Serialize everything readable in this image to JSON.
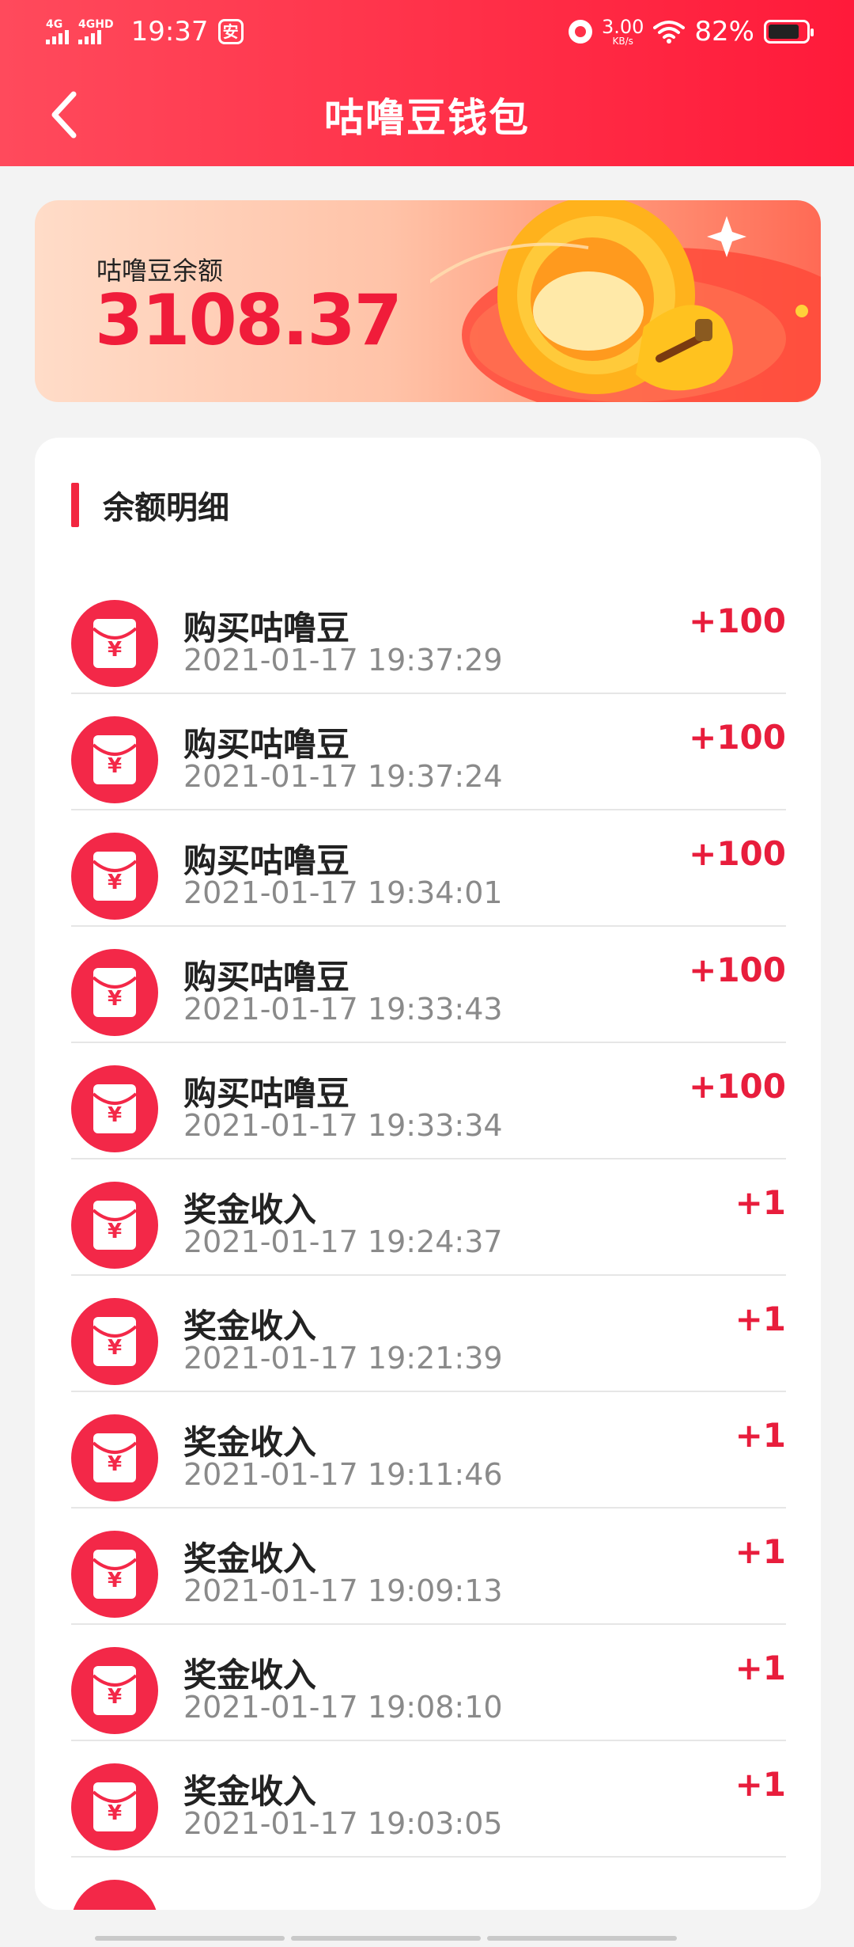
{
  "status_bar": {
    "network_1": "4G",
    "network_2": "4GHD",
    "time": "19:37",
    "app_badge": "安",
    "speed_value": "3.00",
    "speed_unit": "KB/s",
    "battery": "82%",
    "battery_level": 0.82
  },
  "header": {
    "title": "咕噜豆钱包",
    "back_icon": "chevron-left-icon"
  },
  "balance": {
    "label": "咕噜豆余额",
    "value": "3108.37"
  },
  "details": {
    "title": "余额明细",
    "transactions": [
      {
        "title": "购买咕噜豆",
        "time": "2021-01-17 19:37:29",
        "amount": "+100"
      },
      {
        "title": "购买咕噜豆",
        "time": "2021-01-17 19:37:24",
        "amount": "+100"
      },
      {
        "title": "购买咕噜豆",
        "time": "2021-01-17 19:34:01",
        "amount": "+100"
      },
      {
        "title": "购买咕噜豆",
        "time": "2021-01-17 19:33:43",
        "amount": "+100"
      },
      {
        "title": "购买咕噜豆",
        "time": "2021-01-17 19:33:34",
        "amount": "+100"
      },
      {
        "title": "奖金收入",
        "time": "2021-01-17 19:24:37",
        "amount": "+1"
      },
      {
        "title": "奖金收入",
        "time": "2021-01-17 19:21:39",
        "amount": "+1"
      },
      {
        "title": "奖金收入",
        "time": "2021-01-17 19:11:46",
        "amount": "+1"
      },
      {
        "title": "奖金收入",
        "time": "2021-01-17 19:09:13",
        "amount": "+1"
      },
      {
        "title": "奖金收入",
        "time": "2021-01-17 19:08:10",
        "amount": "+1"
      },
      {
        "title": "奖金收入",
        "time": "2021-01-17 19:03:05",
        "amount": "+1"
      }
    ],
    "icon_symbol": "¥",
    "icon_name": "red-envelope-icon"
  },
  "colors": {
    "brand_red": "#ff2d46",
    "amount_red": "#e81d3c",
    "secondary_text": "#8a8a8a"
  }
}
